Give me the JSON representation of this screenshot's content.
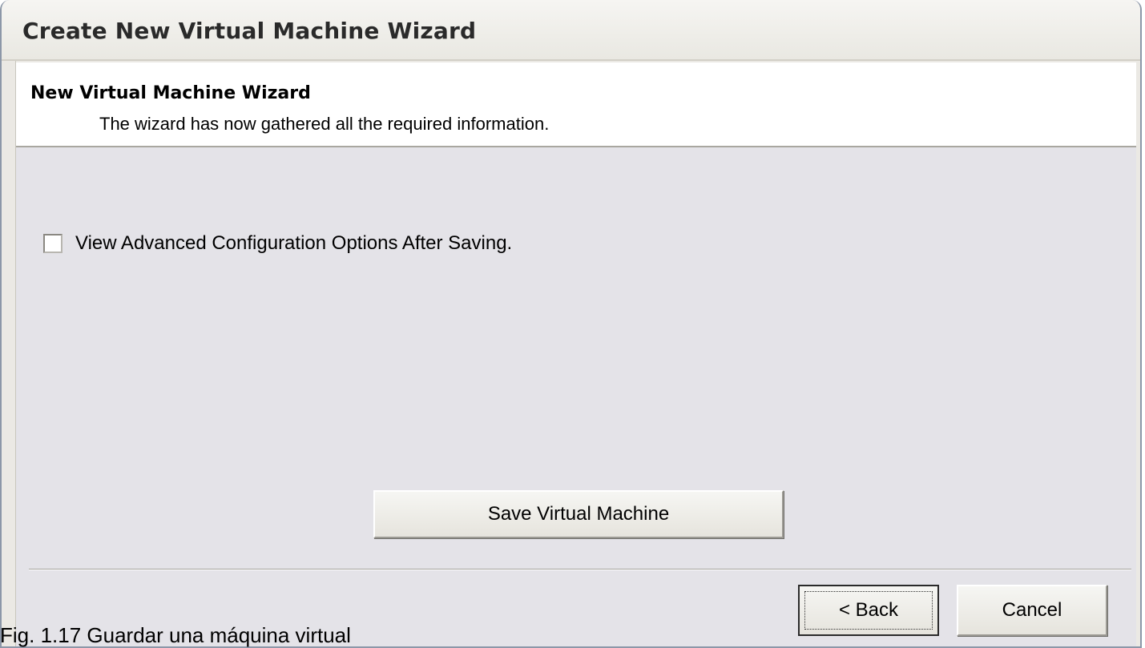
{
  "window": {
    "title": "Create New Virtual Machine Wizard"
  },
  "header": {
    "title": "New Virtual Machine Wizard",
    "subtitle": "The wizard has now gathered all the required information."
  },
  "options": {
    "advanced_checkbox_label": "View Advanced Configuration Options After Saving.",
    "advanced_checkbox_checked": false
  },
  "actions": {
    "save_label": "Save Virtual Machine",
    "back_label": "< Back",
    "cancel_label": "Cancel"
  },
  "caption": {
    "text": "Fig. 1.17 Guardar una máquina virtual"
  }
}
